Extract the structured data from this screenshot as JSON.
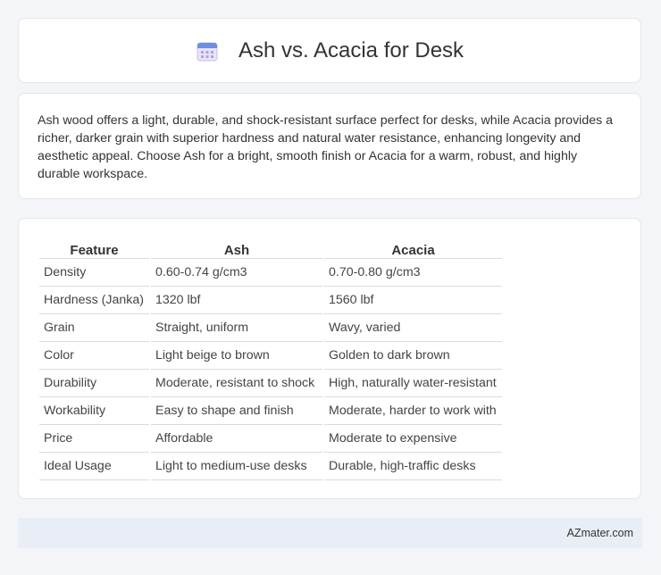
{
  "header": {
    "title": "Ash vs. Acacia for Desk",
    "icon": "calendar-icon"
  },
  "intro": {
    "text": "Ash wood offers a light, durable, and shock-resistant surface perfect for desks, while Acacia provides a richer, darker grain with superior hardness and natural water resistance, enhancing longevity and aesthetic appeal. Choose Ash for a bright, smooth finish or Acacia for a warm, robust, and highly durable workspace."
  },
  "table": {
    "headers": [
      "Feature",
      "Ash",
      "Acacia"
    ],
    "rows": [
      [
        "Density",
        "0.60-0.74 g/cm3",
        "0.70-0.80 g/cm3"
      ],
      [
        "Hardness (Janka)",
        "1320 lbf",
        "1560 lbf"
      ],
      [
        "Grain",
        "Straight, uniform",
        "Wavy, varied"
      ],
      [
        "Color",
        "Light beige to brown",
        "Golden to dark brown"
      ],
      [
        "Durability",
        "Moderate, resistant to shock",
        "High, naturally water-resistant"
      ],
      [
        "Workability",
        "Easy to shape and finish",
        "Moderate, harder to work with"
      ],
      [
        "Price",
        "Affordable",
        "Moderate to expensive"
      ],
      [
        "Ideal Usage",
        "Light to medium-use desks",
        "Durable, high-traffic desks"
      ]
    ]
  },
  "footer": {
    "text": "AZmater.com"
  }
}
